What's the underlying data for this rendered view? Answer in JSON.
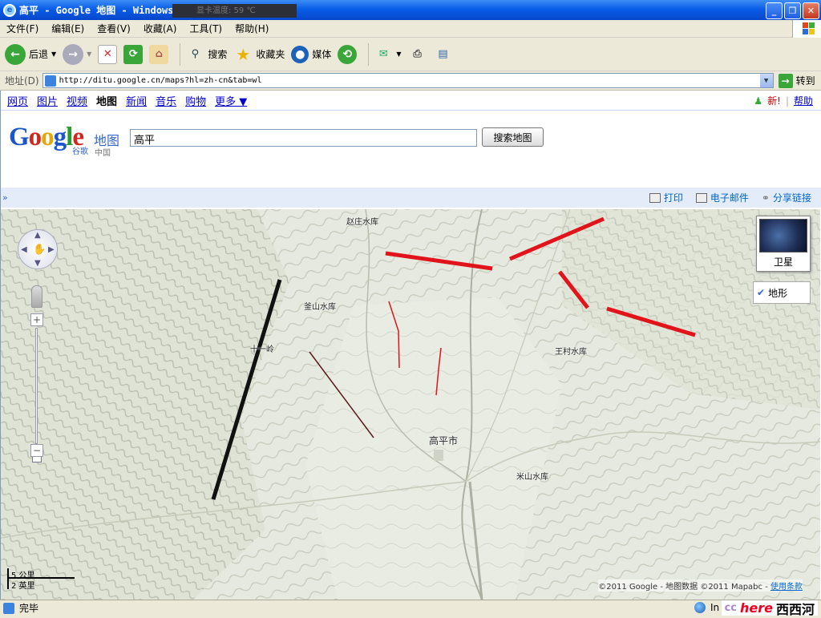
{
  "window": {
    "title": "高平 - Google 地图 - Windows Internet Explorer",
    "obscured": "显卡温度: 59 ℃"
  },
  "menu": [
    "文件(F)",
    "编辑(E)",
    "查看(V)",
    "收藏(A)",
    "工具(T)",
    "帮助(H)"
  ],
  "toolbar": {
    "back": "后退",
    "search": "搜索",
    "favorites": "收藏夹",
    "media": "媒体"
  },
  "address": {
    "label": "地址(D)",
    "url": "http://ditu.google.cn/maps?hl=zh-cn&tab=wl",
    "go": "转到"
  },
  "google_bar": {
    "links": [
      {
        "label": "网页"
      },
      {
        "label": "图片"
      },
      {
        "label": "视频"
      },
      {
        "label": "地图",
        "current": true
      },
      {
        "label": "新闻"
      },
      {
        "label": "音乐"
      },
      {
        "label": "购物"
      },
      {
        "label": "更多 ▼"
      }
    ],
    "new": "新!",
    "help": "帮助"
  },
  "logo": {
    "letters": [
      "G",
      "o",
      "o",
      "g",
      "l",
      "e"
    ],
    "product": "地图",
    "brand_cn": "谷歌",
    "region": "中国"
  },
  "search": {
    "value": "高平",
    "button": "搜索地图"
  },
  "actions": {
    "print": "打印",
    "email": "电子邮件",
    "share": "分享链接"
  },
  "map": {
    "labels": [
      "赵庄水库",
      "釜山水库",
      "十一岭",
      "王村水库",
      "高平市",
      "米山水库"
    ],
    "controls": {
      "satellite": "卫星",
      "terrain": "地形",
      "zoom_in": "+",
      "zoom_out": "−"
    },
    "scale": {
      "metric": "5 公里",
      "imperial": "2 英里"
    },
    "copyright": {
      "text": "©2011 Google - 地图数据 ©2011 Mapabc -",
      "terms": "使用条款"
    }
  },
  "status": {
    "text": "完毕",
    "zone": "In",
    "watermark_cc": "cc",
    "watermark_here": "here",
    "watermark_cn": "西西河"
  }
}
